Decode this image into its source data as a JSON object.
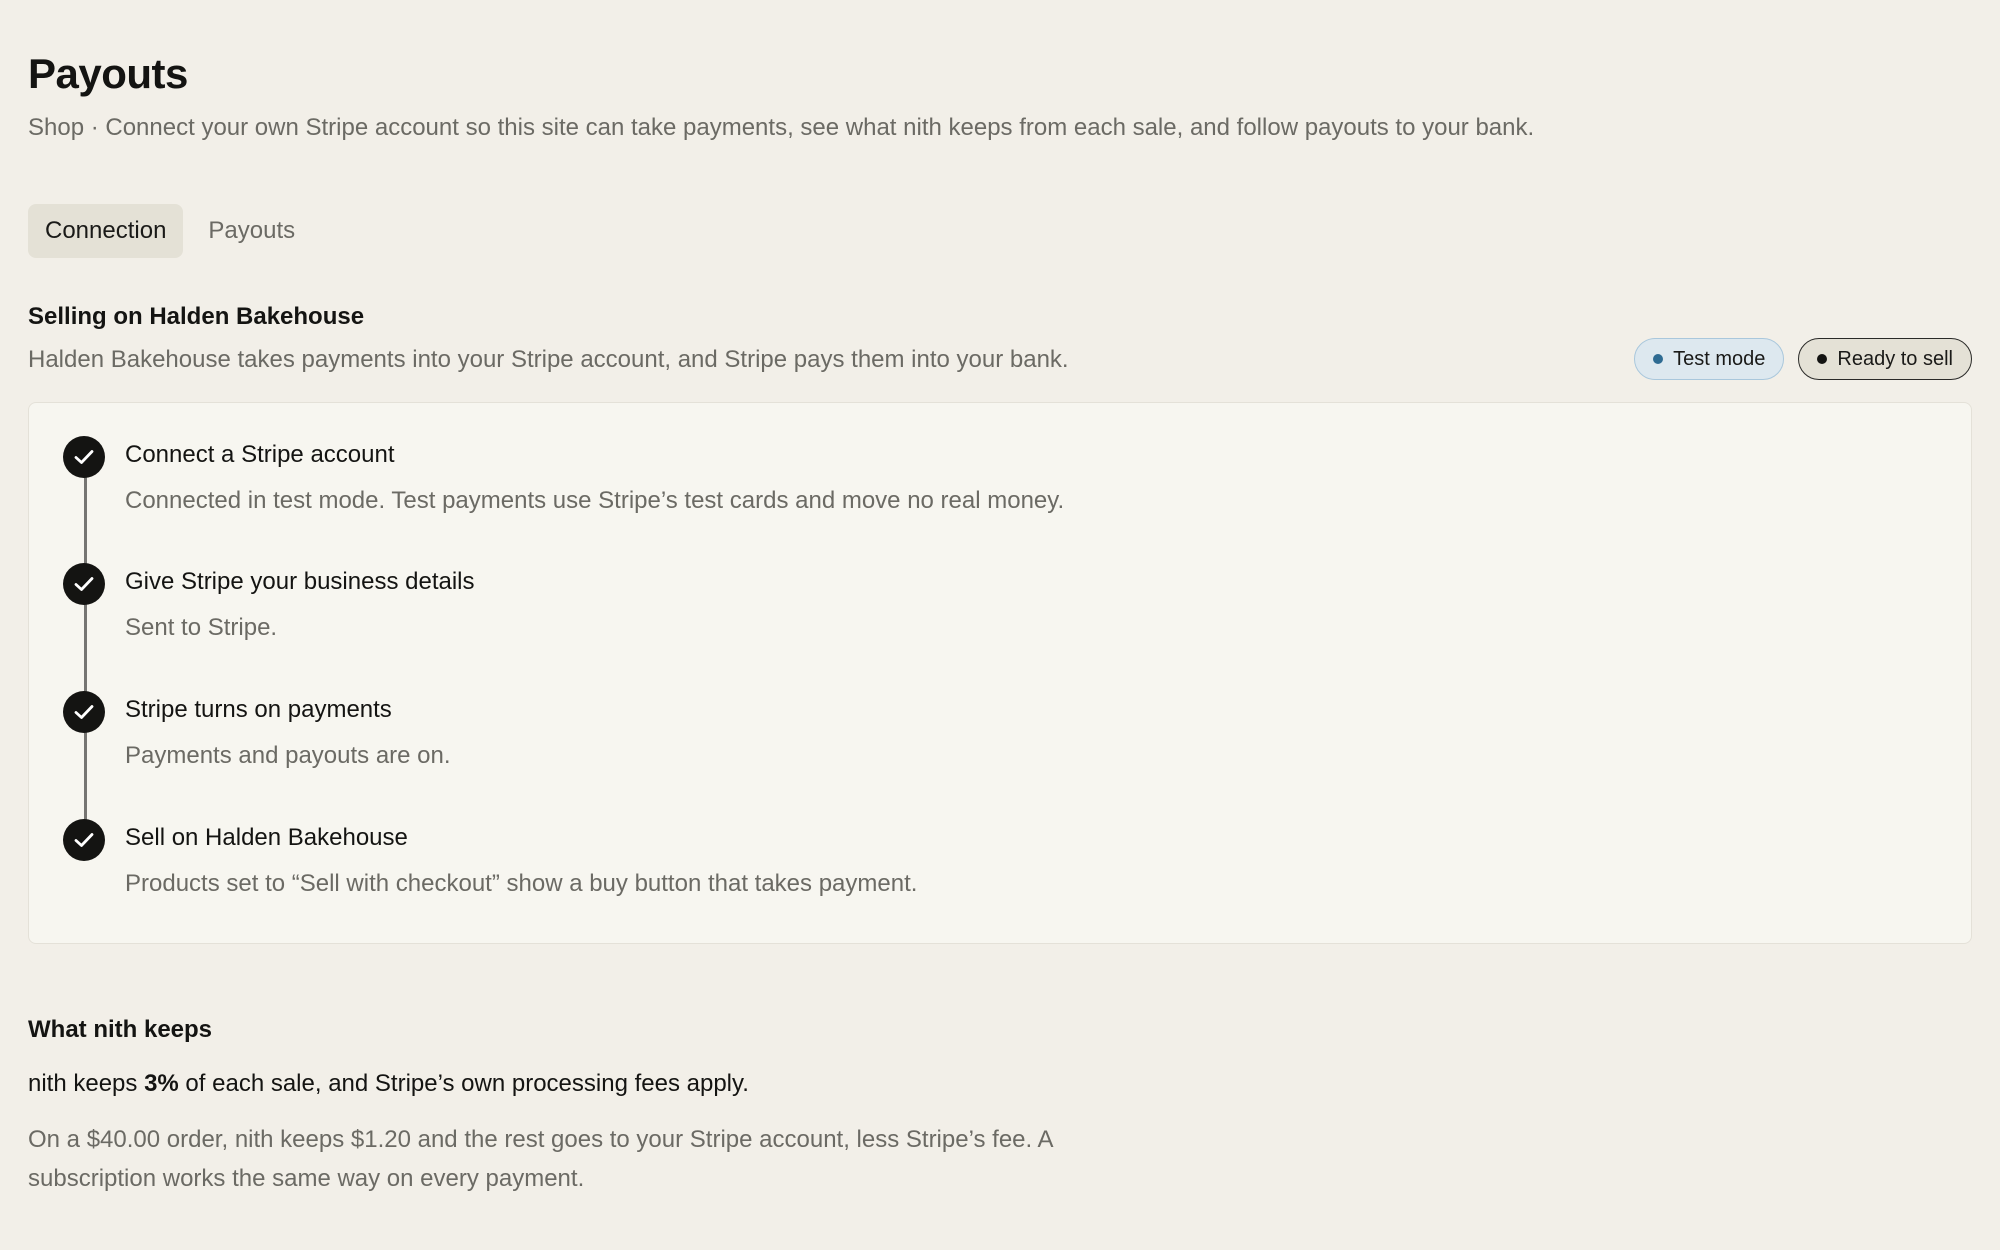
{
  "header": {
    "title": "Payouts",
    "subtitle": "Shop · Connect your own Stripe account so this site can take payments, see what nith keeps from each sale, and follow payouts to your bank."
  },
  "tabs": [
    {
      "label": "Connection",
      "active": true
    },
    {
      "label": "Payouts",
      "active": false
    }
  ],
  "selling": {
    "title": "Selling on Halden Bakehouse",
    "description": "Halden Bakehouse takes payments into your Stripe account, and Stripe pays them into your bank.",
    "badges": {
      "test_mode": "Test mode",
      "ready": "Ready to sell"
    },
    "steps": [
      {
        "title": "Connect a Stripe account",
        "description": "Connected in test mode. Test payments use Stripe’s test cards and move no real money.",
        "icon": "check-icon"
      },
      {
        "title": "Give Stripe your business details",
        "description": "Sent to Stripe.",
        "icon": "check-icon"
      },
      {
        "title": "Stripe turns on payments",
        "description": "Payments and payouts are on.",
        "icon": "check-icon"
      },
      {
        "title": "Sell on Halden Bakehouse",
        "description": "Products set to “Sell with checkout” show a buy button that takes payment.",
        "icon": "check-icon"
      }
    ]
  },
  "keeps": {
    "title": "What nith keeps",
    "fee_prefix": "nith keeps ",
    "fee_percent": "3%",
    "fee_suffix": " of each sale, and Stripe’s own processing fees apply.",
    "example": "On a $40.00 order, nith keeps $1.20 and the rest goes to your Stripe account, less Stripe’s fee. A subscription works the same way on every payment."
  },
  "colors": {
    "background": "#f2efe8",
    "card": "#f7f6f0",
    "accent_dark": "#141412",
    "test_badge": "#dde8ef",
    "test_dot": "#2e6b92"
  }
}
